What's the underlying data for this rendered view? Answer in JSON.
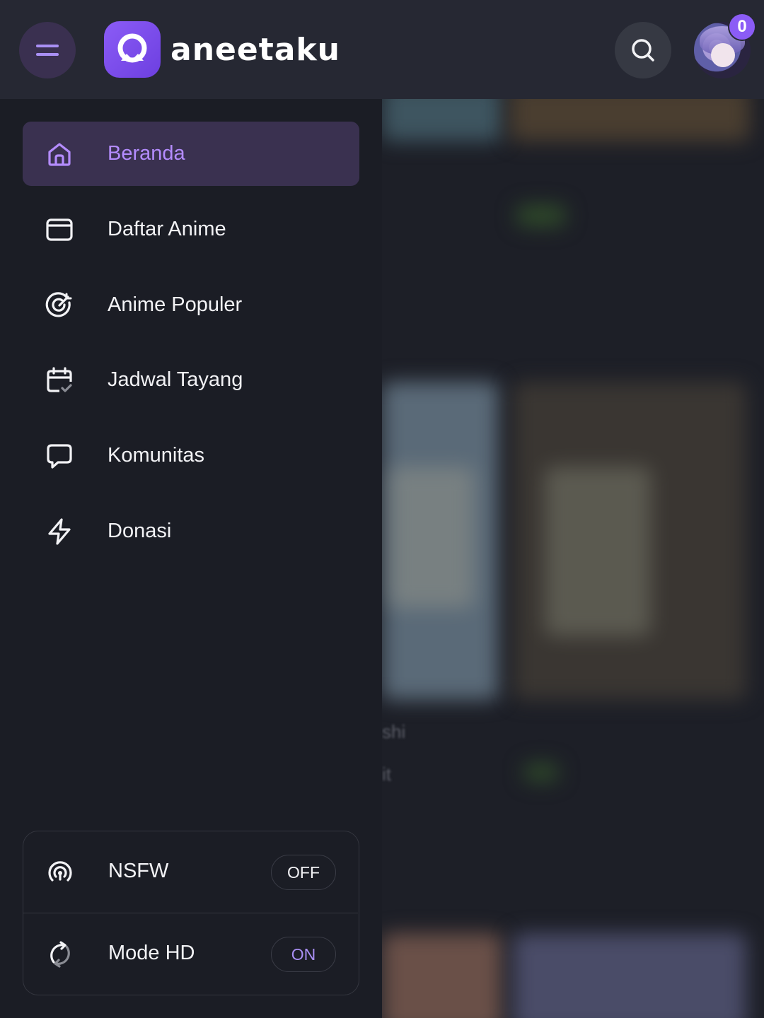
{
  "header": {
    "brand_name": "aneetaku",
    "notification_count": "0",
    "colors": {
      "accent": "#8b5cf6",
      "header_bg": "#262833"
    }
  },
  "sidebar": {
    "items": [
      {
        "label": "Beranda",
        "icon": "home-icon",
        "active": true
      },
      {
        "label": "Daftar Anime",
        "icon": "browser-window-icon",
        "active": false
      },
      {
        "label": "Anime Populer",
        "icon": "target-icon",
        "active": false
      },
      {
        "label": "Jadwal Tayang",
        "icon": "calendar-check-icon",
        "active": false
      },
      {
        "label": "Komunitas",
        "icon": "chat-bubble-icon",
        "active": false
      },
      {
        "label": "Donasi",
        "icon": "lightning-icon",
        "active": false
      }
    ],
    "toggles": [
      {
        "label": "NSFW",
        "icon": "broadcast-icon",
        "state": "OFF"
      },
      {
        "label": "Mode HD",
        "icon": "refresh-icon",
        "state": "ON"
      }
    ]
  },
  "background": {
    "partial_text_1": "shi",
    "partial_text_2": "it"
  }
}
